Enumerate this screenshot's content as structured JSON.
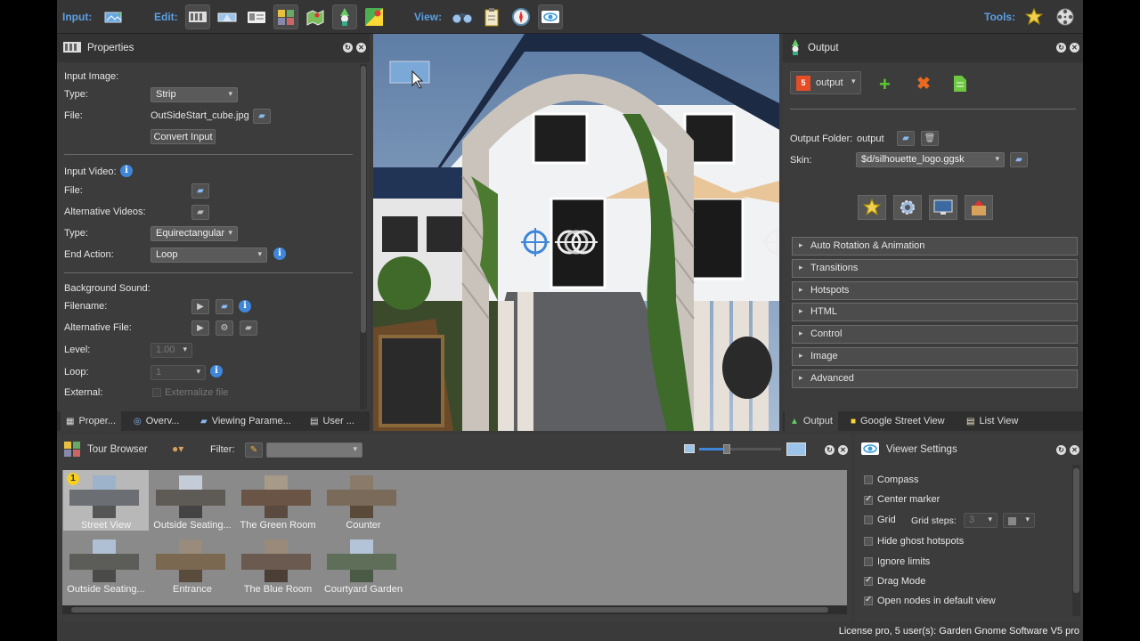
{
  "toolbar": {
    "input_label": "Input:",
    "edit_label": "Edit:",
    "view_label": "View:",
    "tools_label": "Tools:"
  },
  "properties": {
    "title": "Properties",
    "input_image_header": "Input Image:",
    "type_label": "Type:",
    "type_value": "Strip",
    "file_label": "File:",
    "file_value": "OutSideStart_cube.jpg",
    "convert_button": "Convert Input",
    "input_video_header": "Input Video:",
    "video_file_label": "File:",
    "alt_videos_label": "Alternative Videos:",
    "video_type_label": "Type:",
    "video_type_value": "Equirectangular",
    "end_action_label": "End Action:",
    "end_action_value": "Loop",
    "bg_sound_header": "Background Sound:",
    "filename_label": "Filename:",
    "alt_file_label": "Alternative File:",
    "level_label": "Level:",
    "level_value": "1.00",
    "loop_label": "Loop:",
    "loop_value": "1",
    "external_label": "External:",
    "externalize_label": "Externalize file"
  },
  "left_tabs": [
    "Proper...",
    "Overv...",
    "Viewing Parame...",
    "User ..."
  ],
  "output": {
    "title": "Output",
    "format_value": "output",
    "folder_label": "Output Folder:",
    "folder_value": "output",
    "skin_label": "Skin:",
    "skin_value": "$d/silhouette_logo.ggsk",
    "sections": [
      "Auto Rotation & Animation",
      "Transitions",
      "Hotspots",
      "HTML",
      "Control",
      "Image",
      "Advanced"
    ]
  },
  "right_tabs": [
    "Output",
    "Google Street View",
    "List View"
  ],
  "tour_browser": {
    "title": "Tour Browser",
    "filter_label": "Filter:",
    "filter_value": "",
    "nodes": [
      {
        "label": "Street View",
        "badge": "1"
      },
      {
        "label": "Outside Seating..."
      },
      {
        "label": "The Green Room"
      },
      {
        "label": "Counter"
      },
      {
        "label": "Outside Seating..."
      },
      {
        "label": "Entrance"
      },
      {
        "label": "The Blue Room"
      },
      {
        "label": "Courtyard Garden"
      }
    ]
  },
  "viewer_settings": {
    "title": "Viewer Settings",
    "items": [
      {
        "label": "Compass",
        "checked": false
      },
      {
        "label": "Center marker",
        "checked": true
      },
      {
        "label": "Grid",
        "checked": false
      },
      {
        "label": "Hide ghost hotspots",
        "checked": false
      },
      {
        "label": "Ignore limits",
        "checked": false
      },
      {
        "label": "Drag Mode",
        "checked": true
      },
      {
        "label": "Open nodes in default view",
        "checked": true
      }
    ],
    "grid_steps_label": "Grid steps:",
    "grid_steps_value": "3"
  },
  "status": {
    "license": "License pro, 5 user(s): Garden Gnome Software V5 pro"
  },
  "colors": {
    "accent": "#5aa0e6",
    "info": "#3f86d9",
    "selected_thumb": "#b8b8b8"
  }
}
